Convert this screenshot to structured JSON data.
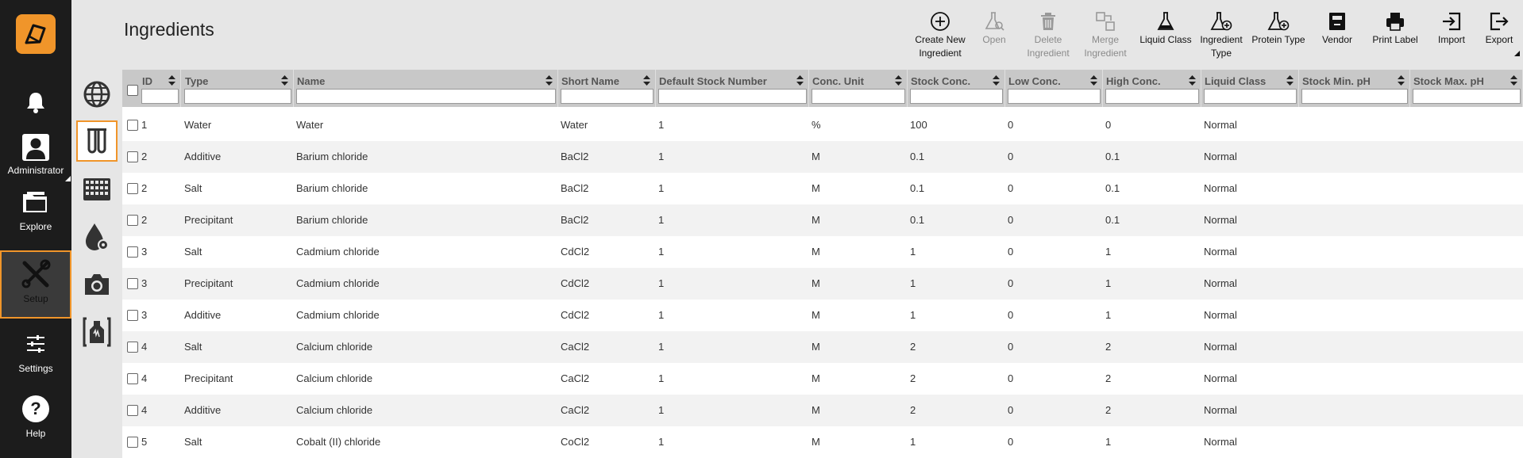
{
  "nav": {
    "items": [
      {
        "name": "notifications",
        "label": ""
      },
      {
        "name": "administrator",
        "label": "Administrator"
      },
      {
        "name": "explore",
        "label": "Explore"
      },
      {
        "name": "setup",
        "label": "Setup"
      },
      {
        "name": "settings",
        "label": "Settings"
      },
      {
        "name": "help",
        "label": "Help"
      }
    ]
  },
  "page": {
    "title": "Ingredients"
  },
  "toolbar": {
    "buttons": [
      {
        "id": "create",
        "line1": "Create New",
        "line2": "Ingredient",
        "enabled": true
      },
      {
        "id": "open",
        "line1": "Open",
        "line2": "",
        "enabled": false
      },
      {
        "id": "delete",
        "line1": "Delete",
        "line2": "Ingredient",
        "enabled": false
      },
      {
        "id": "merge",
        "line1": "Merge",
        "line2": "Ingredient",
        "enabled": false
      },
      {
        "id": "liquid-class",
        "line1": "Liquid Class",
        "line2": "",
        "enabled": true
      },
      {
        "id": "ingredient-type",
        "line1": "Ingredient",
        "line2": "Type",
        "enabled": true
      },
      {
        "id": "protein-type",
        "line1": "Protein Type",
        "line2": "",
        "enabled": true
      },
      {
        "id": "vendor",
        "line1": "Vendor",
        "line2": "",
        "enabled": true
      },
      {
        "id": "print-label",
        "line1": "Print Label",
        "line2": "",
        "enabled": true
      },
      {
        "id": "import",
        "line1": "Import",
        "line2": "",
        "enabled": true
      },
      {
        "id": "export",
        "line1": "Export",
        "line2": "",
        "enabled": true
      }
    ]
  },
  "table": {
    "columns": [
      "ID",
      "Type",
      "Name",
      "Short Name",
      "Default Stock Number",
      "Conc. Unit",
      "Stock Conc.",
      "Low Conc.",
      "High Conc.",
      "Liquid Class",
      "Stock Min. pH",
      "Stock Max. pH"
    ],
    "rows": [
      [
        "1",
        "Water",
        "Water",
        "Water",
        "1",
        "%",
        "100",
        "0",
        "0",
        "Normal",
        "",
        ""
      ],
      [
        "2",
        "Additive",
        "Barium chloride",
        "BaCl2",
        "1",
        "M",
        "0.1",
        "0",
        "0.1",
        "Normal",
        "",
        ""
      ],
      [
        "2",
        "Salt",
        "Barium chloride",
        "BaCl2",
        "1",
        "M",
        "0.1",
        "0",
        "0.1",
        "Normal",
        "",
        ""
      ],
      [
        "2",
        "Precipitant",
        "Barium chloride",
        "BaCl2",
        "1",
        "M",
        "0.1",
        "0",
        "0.1",
        "Normal",
        "",
        ""
      ],
      [
        "3",
        "Salt",
        "Cadmium chloride",
        "CdCl2",
        "1",
        "M",
        "1",
        "0",
        "1",
        "Normal",
        "",
        ""
      ],
      [
        "3",
        "Precipitant",
        "Cadmium chloride",
        "CdCl2",
        "1",
        "M",
        "1",
        "0",
        "1",
        "Normal",
        "",
        ""
      ],
      [
        "3",
        "Additive",
        "Cadmium chloride",
        "CdCl2",
        "1",
        "M",
        "1",
        "0",
        "1",
        "Normal",
        "",
        ""
      ],
      [
        "4",
        "Salt",
        "Calcium chloride",
        "CaCl2",
        "1",
        "M",
        "2",
        "0",
        "2",
        "Normal",
        "",
        ""
      ],
      [
        "4",
        "Precipitant",
        "Calcium chloride",
        "CaCl2",
        "1",
        "M",
        "2",
        "0",
        "2",
        "Normal",
        "",
        ""
      ],
      [
        "4",
        "Additive",
        "Calcium chloride",
        "CaCl2",
        "1",
        "M",
        "2",
        "0",
        "2",
        "Normal",
        "",
        ""
      ],
      [
        "5",
        "Salt",
        "Cobalt (II) chloride",
        "CoCl2",
        "1",
        "M",
        "1",
        "0",
        "1",
        "Normal",
        "",
        ""
      ]
    ]
  },
  "colors": {
    "accent": "#f0952a",
    "nav_bg": "#1c1c1c",
    "header_bg": "#c8c8c8"
  }
}
